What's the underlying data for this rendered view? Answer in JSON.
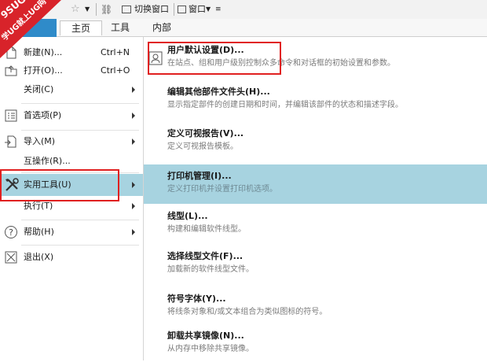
{
  "watermark": {
    "line1": "9SUG",
    "line2": "学UG就上UG网"
  },
  "quick_access": {
    "switch_window": "切换窗口",
    "window": "窗口"
  },
  "tabs": [
    {
      "label": "主页"
    },
    {
      "label": "工具"
    },
    {
      "label": "内部"
    }
  ],
  "left_menu": {
    "new": {
      "label": "新建(N)...",
      "shortcut": "Ctrl+N"
    },
    "open": {
      "label": "打开(O)...",
      "shortcut": "Ctrl+O"
    },
    "close": {
      "label": "关闭(C)"
    },
    "preferences": {
      "label": "首选项(P)"
    },
    "import": {
      "label": "导入(M)"
    },
    "interop": {
      "label": "互操作(R)..."
    },
    "utilities": {
      "label": "实用工具(U)"
    },
    "execute": {
      "label": "执行(T)"
    },
    "help": {
      "label": "帮助(H)"
    },
    "exit": {
      "label": "退出(X)"
    }
  },
  "submenu": [
    {
      "title": "用户默认设置(D)...",
      "desc": "在站点、组和用户级别控制众多命令和对话框的初始设置和参数。"
    },
    {
      "title": "编辑其他部件文件头(H)...",
      "desc": "显示指定部件的创建日期和时间，并编辑该部件的状态和描述字段。"
    },
    {
      "title": "定义可视报告(V)...",
      "desc": "定义可视报告模板。"
    },
    {
      "title": "打印机管理(I)...",
      "desc": "定义打印机并设置打印机选项。"
    },
    {
      "title": "线型(L)...",
      "desc": "构建和编辑软件线型。"
    },
    {
      "title": "选择线型文件(F)...",
      "desc": "加载新的软件线型文件。"
    },
    {
      "title": "符号字体(Y)...",
      "desc": "将线条对象和/或文本组合为类似图标的符号。"
    },
    {
      "title": "卸载共享镜像(N)...",
      "desc": "从内存中移除共享镜像。"
    }
  ],
  "colors": {
    "highlight": "#a7d3e0",
    "file_tab": "#2f8bc9",
    "callout": "#e02020",
    "badge": "#d8232a"
  }
}
